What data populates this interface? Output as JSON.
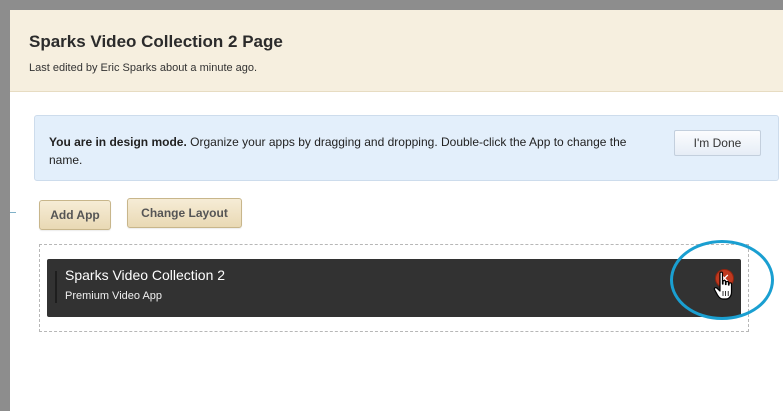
{
  "page": {
    "title": "Sparks Video Collection 2 Page",
    "last_edited": "Last edited by Eric Sparks about a minute ago."
  },
  "notice": {
    "bold_text": "You are in design mode.",
    "text": " Organize your apps by dragging and dropping. Double-click the App to change the name.",
    "done_button": "I'm Done"
  },
  "toolbar": {
    "add_app": "Add App",
    "change_layout": "Change Layout"
  },
  "app": {
    "name": "Sparks Video Collection 2",
    "type": "Premium Video App",
    "remove_icon": "close-icon"
  },
  "colors": {
    "header_bg": "#f6efdf",
    "notice_bg": "#e3effb",
    "tile_bg": "#323232",
    "remove_red": "#c0391f",
    "highlight_ring": "#1a9fd1"
  }
}
